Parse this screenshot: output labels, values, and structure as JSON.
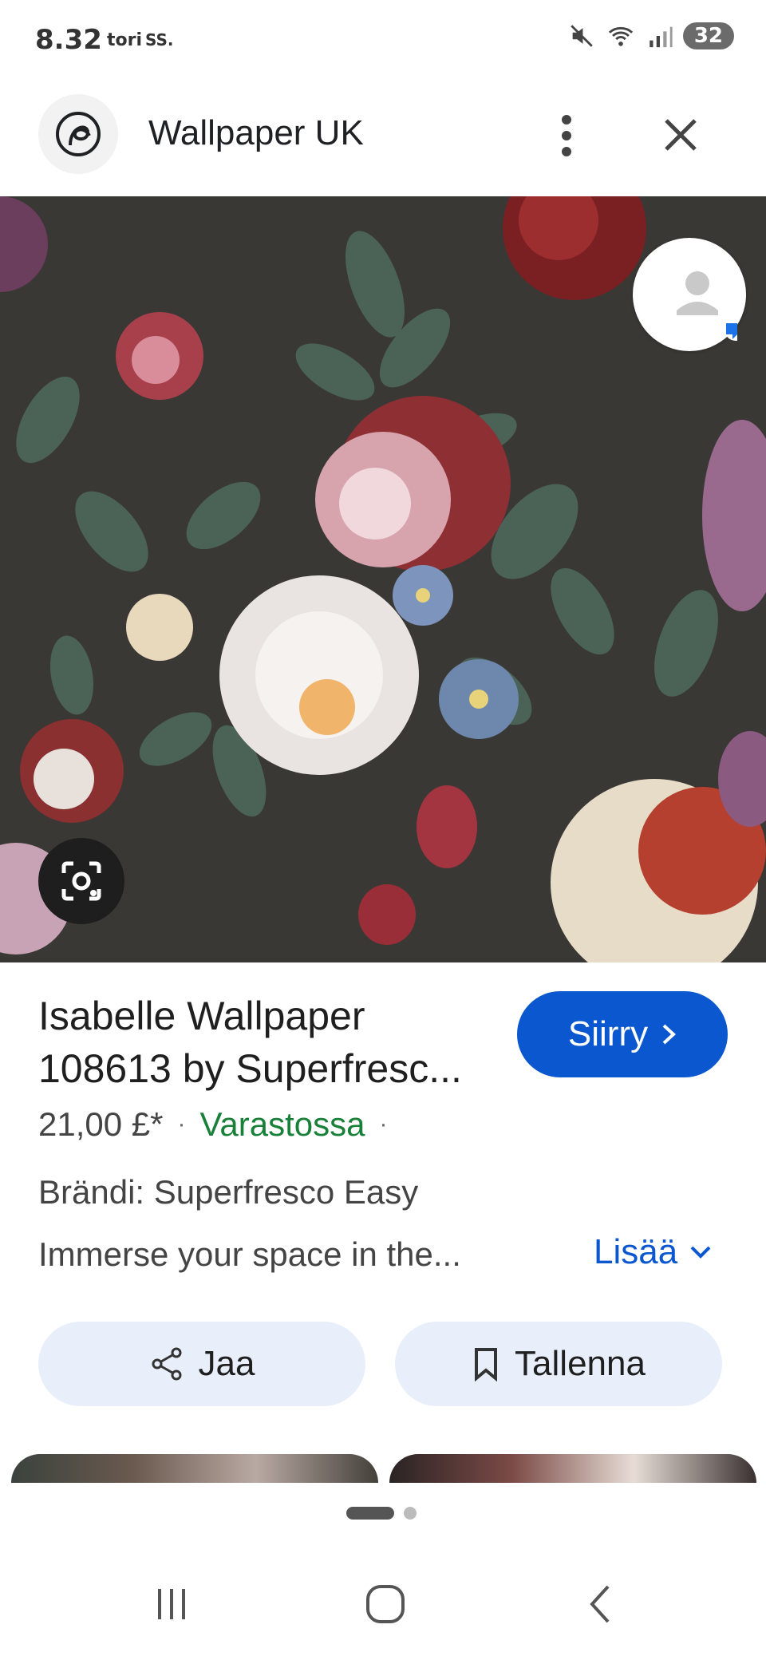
{
  "status_bar": {
    "time": "8.32",
    "day": "tori",
    "carrier": "SS.",
    "battery": "32"
  },
  "header": {
    "title": "Wallpaper UK"
  },
  "product": {
    "title_line1": "Isabelle Wallpaper",
    "title_line2": "108613 by Superfresc...",
    "go_label": "Siirry",
    "price": "21,00 £*",
    "stock": "Varastossa",
    "brand": "Brändi: Superfresco Easy",
    "description": "Immerse your space in the...",
    "more_label": "Lisää"
  },
  "actions": {
    "share_label": "Jaa",
    "save_label": "Tallenna"
  },
  "colors": {
    "accent": "#0b57d0",
    "in_stock": "#188038",
    "chip_bg": "#e8effb"
  },
  "icons": [
    "site-logo-icon",
    "more-vert-icon",
    "close-icon",
    "account-icon",
    "lens-icon",
    "chevron-right-icon",
    "expand-more-icon",
    "share-icon",
    "bookmark-icon",
    "recents-icon",
    "home-icon",
    "back-icon"
  ]
}
